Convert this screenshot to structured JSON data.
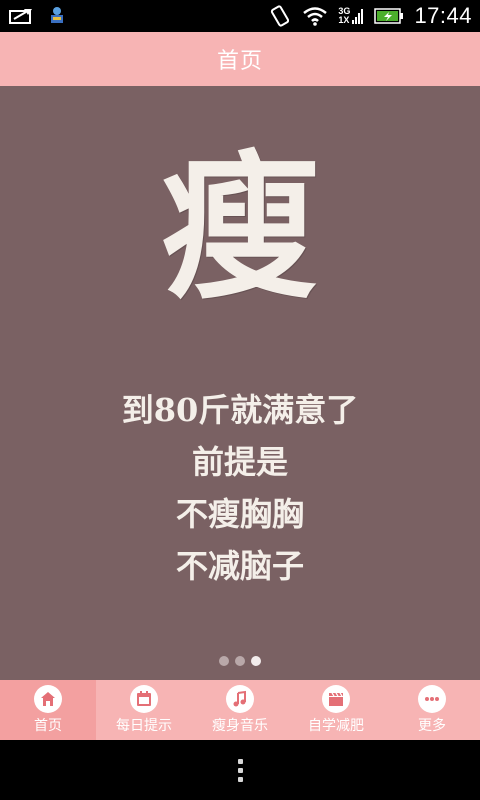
{
  "status_bar": {
    "time": "17:44",
    "network_top": "3G",
    "network_bottom": "1X",
    "icons": [
      "notification-icon",
      "app-icon",
      "vibrate-icon",
      "wifi-icon",
      "signal-icon",
      "battery-icon"
    ]
  },
  "header": {
    "title": "首页"
  },
  "banner": {
    "big_char": "瘦",
    "lines": [
      "到80斤就满意了",
      "前提是",
      "不瘦胸胸",
      "不减脑子"
    ],
    "page_count": 3,
    "active_page": 3
  },
  "tabs": [
    {
      "label": "首页",
      "icon": "home-icon",
      "active": true
    },
    {
      "label": "每日提示",
      "icon": "calendar-icon",
      "active": false
    },
    {
      "label": "瘦身音乐",
      "icon": "music-note-icon",
      "active": false
    },
    {
      "label": "自学减肥",
      "icon": "clapperboard-icon",
      "active": false
    },
    {
      "label": "更多",
      "icon": "more-dots-icon",
      "active": false
    }
  ],
  "colors": {
    "header_bg": "#f7b4b4",
    "banner_bg": "#7a6163",
    "tab_active_bg": "#f3a0a0",
    "accent": "#e46f76"
  }
}
